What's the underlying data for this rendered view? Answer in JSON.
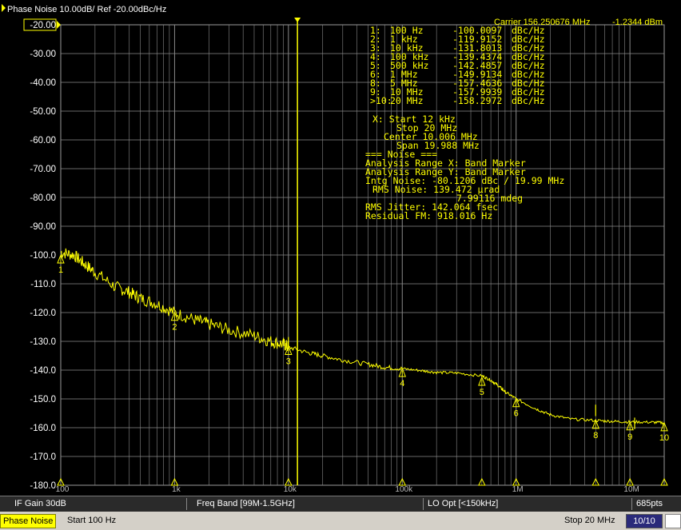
{
  "header": {
    "trace_label": "Phase Noise 10.00dB/ Ref -20.00dBc/Hz",
    "carrier_label": "Carrier 156.250676 MHz",
    "carrier_power": "-1.2344 dBm"
  },
  "marker_table": [
    {
      "num": "1:",
      "freq": "100 Hz",
      "value": "-100.0097",
      "unit": "dBc/Hz"
    },
    {
      "num": "2:",
      "freq": "1 kHz",
      "value": "-119.9152",
      "unit": "dBc/Hz"
    },
    {
      "num": "3:",
      "freq": "10 kHz",
      "value": "-131.8013",
      "unit": "dBc/Hz"
    },
    {
      "num": "4:",
      "freq": "100 kHz",
      "value": "-139.4374",
      "unit": "dBc/Hz"
    },
    {
      "num": "5:",
      "freq": "500 kHz",
      "value": "-142.4857",
      "unit": "dBc/Hz"
    },
    {
      "num": "6:",
      "freq": "1 MHz",
      "value": "-149.9134",
      "unit": "dBc/Hz"
    },
    {
      "num": "8:",
      "freq": "5 MHz",
      "value": "-157.4636",
      "unit": "dBc/Hz"
    },
    {
      "num": "9:",
      "freq": "10 MHz",
      "value": "-157.9939",
      "unit": "dBc/Hz"
    },
    {
      "num": ">10:",
      "freq": "20 MHz",
      "value": "-158.2972",
      "unit": "dBc/Hz"
    }
  ],
  "analysis": {
    "x_start": "X: Start 12 kHz",
    "x_stop": "Stop 20 MHz",
    "x_center": "Center 10.006 MHz",
    "x_span": "Span 19.988 MHz",
    "noise_heading": "=== Noise ===",
    "range_x": "Analysis Range X: Band Marker",
    "range_y": "Analysis Range Y: Band Marker",
    "intg_noise": "Intg Noise: -80.1206 dBc / 19.99 MHz",
    "rms_noise_rad": "RMS Noise: 139.472 µrad",
    "rms_noise_deg": "7.99116 mdeg",
    "rms_jitter": "RMS Jitter: 142.064 fsec",
    "residual_fm": "Residual FM: 918.016 Hz"
  },
  "status_bar": {
    "if_gain": "IF Gain 30dB",
    "freq_band": "Freq Band [99M-1.5GHz]",
    "lo_opt": "LO Opt [<150kHz]",
    "points": "685pts"
  },
  "bottom_bar": {
    "mode": "Phase Noise",
    "start": "Start 100 Hz",
    "stop": "Stop 20 MHz",
    "page": "10/10"
  },
  "chart_data": {
    "type": "line",
    "xscale": "log",
    "xlim": [
      100,
      20000000
    ],
    "ylim": [
      -180,
      -20
    ],
    "y_ticks": [
      "-20.00",
      "-30.00",
      "-40.00",
      "-50.00",
      "-60.00",
      "-70.00",
      "-80.00",
      "-90.00",
      "-100.0",
      "-110.0",
      "-120.0",
      "-130.0",
      "-140.0",
      "-150.0",
      "-160.0",
      "-170.0",
      "-180.0"
    ],
    "x_tick_labels": [
      {
        "x": 100,
        "label": "100"
      },
      {
        "x": 1000,
        "label": "1k"
      },
      {
        "x": 10000,
        "label": "10k"
      },
      {
        "x": 100000,
        "label": "100k"
      },
      {
        "x": 1000000,
        "label": "1M"
      },
      {
        "x": 10000000,
        "label": "10M"
      }
    ],
    "grid": true,
    "color": "#ffff00",
    "series": [
      {
        "x": [
          100,
          130,
          160,
          200,
          300,
          400,
          500,
          700,
          1000,
          1500,
          2000,
          3000,
          5000,
          7000,
          9000,
          10000,
          15000,
          20000,
          30000,
          50000,
          70000,
          100000,
          150000,
          200000,
          300000,
          500000,
          600000,
          700000,
          800000,
          1000000,
          1500000,
          2000000,
          3000000,
          5000000,
          7000000,
          10000000,
          15000000,
          20000000
        ],
        "y": [
          -99,
          -100,
          -103,
          -106,
          -111,
          -113,
          -115,
          -117,
          -120,
          -122.5,
          -124,
          -126,
          -128,
          -130,
          -131,
          -132,
          -134,
          -135,
          -136.5,
          -138,
          -139,
          -139.5,
          -140.2,
          -140.8,
          -141,
          -142,
          -143.5,
          -145.5,
          -147.5,
          -150,
          -153.5,
          -155.5,
          -157,
          -157.5,
          -157.8,
          -158,
          -158.1,
          -158.3
        ]
      }
    ],
    "spurs": [
      {
        "x": 10000,
        "y": -128.5
      },
      {
        "x": 5000000,
        "y": -152
      },
      {
        "x": 11000000,
        "y": -156.5
      }
    ],
    "markers": [
      {
        "label": "1",
        "x": 100,
        "y": -100.0097
      },
      {
        "label": "2",
        "x": 1000,
        "y": -119.9152
      },
      {
        "label": "3",
        "x": 10000,
        "y": -131.8013
      },
      {
        "label": "4",
        "x": 100000,
        "y": -139.4374
      },
      {
        "label": "5",
        "x": 500000,
        "y": -142.4857
      },
      {
        "label": "6",
        "x": 1000000,
        "y": -149.9134
      },
      {
        "label": "8",
        "x": 5000000,
        "y": -157.4636
      },
      {
        "label": "9",
        "x": 10000000,
        "y": -157.9939
      },
      {
        "label": "10",
        "x": 20000000,
        "y": -158.2972
      }
    ],
    "band_marker_start": 12000
  }
}
